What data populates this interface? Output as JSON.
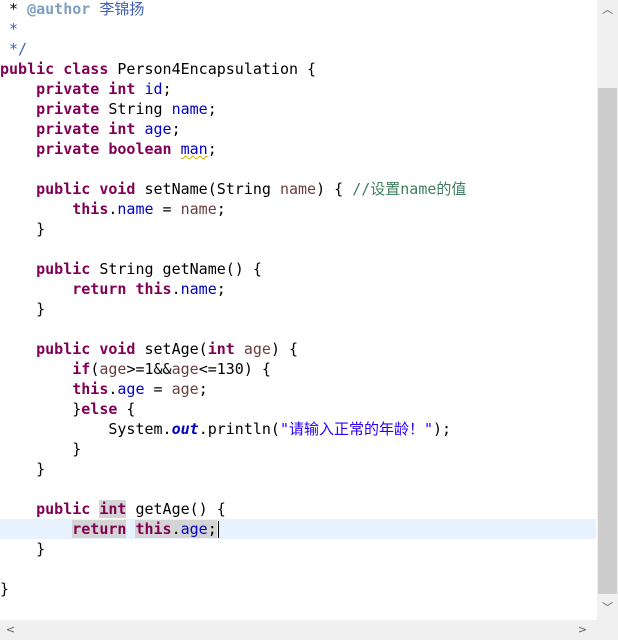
{
  "editor": {
    "lines": [
      [
        {
          "t": " * "
        },
        {
          "t": "@author",
          "c": "doctag"
        },
        {
          "t": " 李锦扬",
          "c": "doc"
        }
      ],
      [
        {
          "t": " *",
          "c": "doc"
        }
      ],
      [
        {
          "t": " */",
          "c": "doc"
        }
      ],
      [
        {
          "t": "public",
          "c": "kw"
        },
        {
          "t": " "
        },
        {
          "t": "class",
          "c": "kw"
        },
        {
          "t": " Person4Encapsulation {"
        }
      ],
      [
        {
          "t": "    "
        },
        {
          "t": "private",
          "c": "kw"
        },
        {
          "t": " "
        },
        {
          "t": "int",
          "c": "kw"
        },
        {
          "t": " "
        },
        {
          "t": "id",
          "c": "field"
        },
        {
          "t": ";"
        }
      ],
      [
        {
          "t": "    "
        },
        {
          "t": "private",
          "c": "kw"
        },
        {
          "t": " String "
        },
        {
          "t": "name",
          "c": "field"
        },
        {
          "t": ";"
        }
      ],
      [
        {
          "t": "    "
        },
        {
          "t": "private",
          "c": "kw"
        },
        {
          "t": " "
        },
        {
          "t": "int",
          "c": "kw"
        },
        {
          "t": " "
        },
        {
          "t": "age",
          "c": "field"
        },
        {
          "t": ";"
        }
      ],
      [
        {
          "t": "    "
        },
        {
          "t": "private",
          "c": "kw"
        },
        {
          "t": " "
        },
        {
          "t": "boolean",
          "c": "kw"
        },
        {
          "t": " "
        },
        {
          "t": "man",
          "c": "field warn"
        },
        {
          "t": ";"
        }
      ],
      [],
      [
        {
          "t": "    "
        },
        {
          "t": "public",
          "c": "kw"
        },
        {
          "t": " "
        },
        {
          "t": "void",
          "c": "kw"
        },
        {
          "t": " setName(String "
        },
        {
          "t": "name",
          "c": "local"
        },
        {
          "t": ") { "
        },
        {
          "t": "//设置name的值",
          "c": "cmt"
        }
      ],
      [
        {
          "t": "        "
        },
        {
          "t": "this",
          "c": "kw"
        },
        {
          "t": "."
        },
        {
          "t": "name",
          "c": "field"
        },
        {
          "t": " = "
        },
        {
          "t": "name",
          "c": "local"
        },
        {
          "t": ";"
        }
      ],
      [
        {
          "t": "    }"
        }
      ],
      [],
      [
        {
          "t": "    "
        },
        {
          "t": "public",
          "c": "kw"
        },
        {
          "t": " String getName() {"
        }
      ],
      [
        {
          "t": "        "
        },
        {
          "t": "return",
          "c": "kw"
        },
        {
          "t": " "
        },
        {
          "t": "this",
          "c": "kw"
        },
        {
          "t": "."
        },
        {
          "t": "name",
          "c": "field"
        },
        {
          "t": ";"
        }
      ],
      [
        {
          "t": "    }"
        }
      ],
      [],
      [
        {
          "t": "    "
        },
        {
          "t": "public",
          "c": "kw"
        },
        {
          "t": " "
        },
        {
          "t": "void",
          "c": "kw"
        },
        {
          "t": " setAge("
        },
        {
          "t": "int",
          "c": "kw"
        },
        {
          "t": " "
        },
        {
          "t": "age",
          "c": "local"
        },
        {
          "t": ") {"
        }
      ],
      [
        {
          "t": "        "
        },
        {
          "t": "if",
          "c": "kw"
        },
        {
          "t": "("
        },
        {
          "t": "age",
          "c": "local"
        },
        {
          "t": ">=1&&"
        },
        {
          "t": "age",
          "c": "local"
        },
        {
          "t": "<=130) {"
        }
      ],
      [
        {
          "t": "        "
        },
        {
          "t": "this",
          "c": "kw"
        },
        {
          "t": "."
        },
        {
          "t": "age",
          "c": "field"
        },
        {
          "t": " = "
        },
        {
          "t": "age",
          "c": "local"
        },
        {
          "t": ";"
        }
      ],
      [
        {
          "t": "        }"
        },
        {
          "t": "else",
          "c": "kw"
        },
        {
          "t": " {"
        }
      ],
      [
        {
          "t": "            System."
        },
        {
          "t": "out",
          "c": "field-static"
        },
        {
          "t": ".println("
        },
        {
          "t": "\"请输入正常的年龄！\"",
          "c": "str"
        },
        {
          "t": ");"
        }
      ],
      [
        {
          "t": "        }"
        }
      ],
      [
        {
          "t": "    }"
        }
      ],
      [],
      [
        {
          "t": "    "
        },
        {
          "t": "public",
          "c": "kw"
        },
        {
          "t": " "
        },
        {
          "t": "int",
          "c": "kw occ"
        },
        {
          "t": " getAge() {"
        }
      ],
      [
        {
          "t": "        "
        },
        {
          "t": "return",
          "c": "kw occ"
        },
        {
          "t": " "
        },
        {
          "t": "this",
          "c": "kw occ"
        },
        {
          "t": ".",
          "c": "occ"
        },
        {
          "t": "age",
          "c": "field occ"
        },
        {
          "t": ";",
          "c": "occ"
        },
        {
          "caret": true
        }
      ],
      [
        {
          "t": "    }"
        }
      ],
      [],
      [
        {
          "t": "}"
        }
      ]
    ],
    "current_line": 26
  },
  "scrollbars": {
    "up_arrow": "︿",
    "down_arrow": "﹀",
    "left_arrow": "<",
    "right_arrow": ">"
  }
}
